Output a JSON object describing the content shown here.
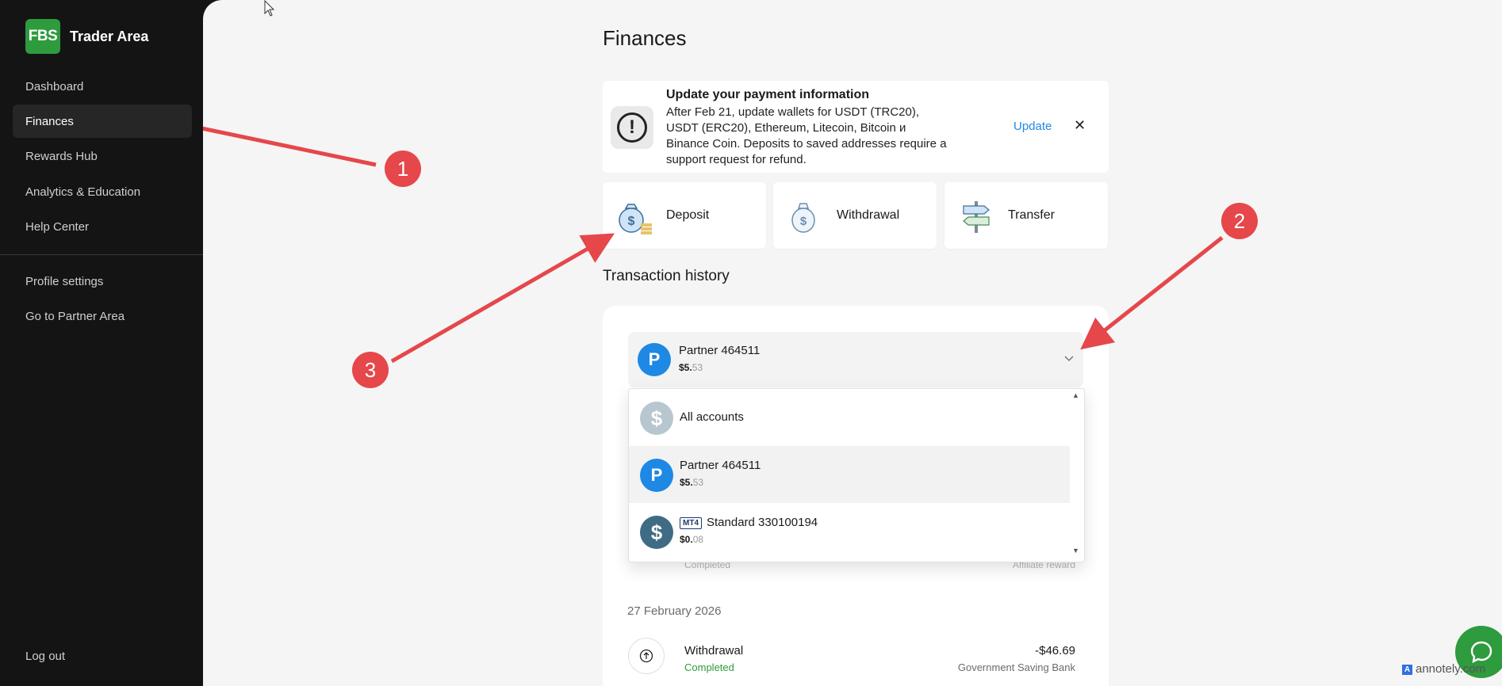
{
  "sidebar": {
    "logo": {
      "mark": "FBS",
      "title": "Trader Area"
    },
    "items": [
      {
        "label": "Dashboard"
      },
      {
        "label": "Finances"
      },
      {
        "label": "Rewards Hub"
      },
      {
        "label": "Analytics & Education"
      },
      {
        "label": "Help Center"
      }
    ],
    "secondary": [
      {
        "label": "Profile settings"
      },
      {
        "label": "Go to Partner Area"
      }
    ],
    "logout": "Log out"
  },
  "page": {
    "title": "Finances"
  },
  "banner": {
    "icon": "alert-icon",
    "title": "Update your payment information",
    "text": "After Feb 21, update wallets for USDT (TRC20), USDT (ERC20), Ethereum, Litecoin, Bitcoin и Binance Coin. Deposits to saved addresses require a support request for refund.",
    "action": "Update",
    "close": "✕"
  },
  "actions": [
    {
      "label": "Deposit",
      "icon": "money-bag-icon"
    },
    {
      "label": "Withdrawal",
      "icon": "money-bag-out-icon"
    },
    {
      "label": "Transfer",
      "icon": "signpost-icon"
    }
  ],
  "history": {
    "title": "Transaction history",
    "selected_account": {
      "avatar": "P",
      "name": "Partner 464511",
      "balance_main": "$5.",
      "balance_cents": "53"
    },
    "dropdown": [
      {
        "avatar": "$",
        "name": "All accounts"
      },
      {
        "avatar": "P",
        "name": "Partner 464511",
        "balance_main": "$5.",
        "balance_cents": "53"
      },
      {
        "avatar": "$",
        "badge": "MT4",
        "name": "Standard 330100194",
        "balance_main": "$0.",
        "balance_cents": "08"
      }
    ],
    "partial_row": {
      "status": "Completed",
      "type": "Affiliate reward"
    },
    "date": "27 February 2026",
    "transactions": [
      {
        "name": "Withdrawal",
        "status": "Completed",
        "amount": "-$46.69",
        "method": "Government Saving Bank"
      }
    ]
  },
  "annotations": [
    "1",
    "2",
    "3"
  ],
  "watermark": "annotely.com",
  "colors": {
    "brand": "#2e9b3e",
    "accent_link": "#1e88e5",
    "annotation": "#e5474b",
    "partner_avatar": "#1e88e5",
    "standard_avatar": "#3f6b85"
  }
}
